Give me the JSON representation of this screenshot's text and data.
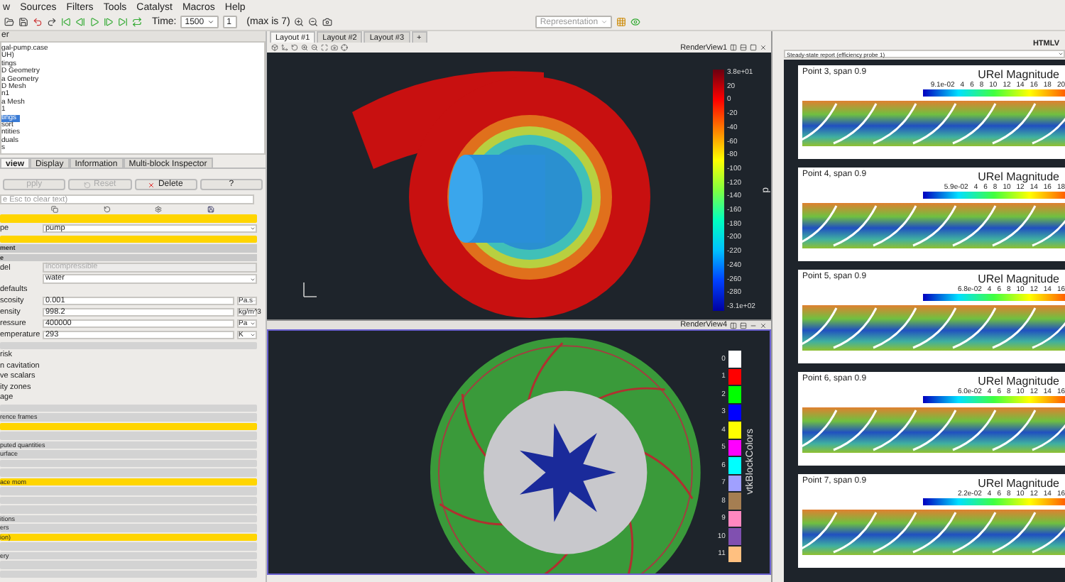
{
  "menu": [
    "w",
    "Sources",
    "Filters",
    "Tools",
    "Catalyst",
    "Macros",
    "Help"
  ],
  "time": {
    "label": "Time:",
    "value": "1500",
    "index": "1",
    "max": "(max is 7)"
  },
  "representation": {
    "placeholder": "Representation"
  },
  "pipeline": {
    "title": "er",
    "items": [
      {
        "label": "gal-pump.case",
        "selected": false
      },
      {
        "label": "UH)",
        "selected": false
      },
      {
        "label": "tings",
        "selected": false
      },
      {
        "label": "D Geometry",
        "selected": false
      },
      {
        "label": "a Geometry",
        "selected": false
      },
      {
        "label": "D Mesh",
        "selected": false
      },
      {
        "label": "n1",
        "selected": false
      },
      {
        "label": "a Mesh",
        "selected": false
      },
      {
        "label": "1",
        "selected": false
      },
      {
        "label": "tings",
        "selected": true
      },
      {
        "label": "sort",
        "selected": false
      },
      {
        "label": "ntities",
        "selected": false
      },
      {
        "label": "duals",
        "selected": false
      },
      {
        "label": "s",
        "selected": false
      }
    ]
  },
  "panel_tabs": [
    {
      "label": "view",
      "selected": true
    },
    {
      "label": "Display",
      "selected": false
    },
    {
      "label": "Information",
      "selected": false
    },
    {
      "label": "Multi-block Inspector",
      "selected": false
    }
  ],
  "actions": [
    {
      "label": "pply",
      "kind": "apply",
      "disabled": true
    },
    {
      "label": "Reset",
      "kind": "reset",
      "disabled": true
    },
    {
      "label": "Delete",
      "kind": "delete",
      "disabled": false
    },
    {
      "label": "?",
      "kind": "help",
      "disabled": false
    }
  ],
  "search": {
    "placeholder": "e Esc to clear text)"
  },
  "properties": [
    {
      "kind": "bar",
      "highlighted": true
    },
    {
      "kind": "select",
      "label": "pe",
      "value": "pump"
    },
    {
      "kind": "bar",
      "highlighted": true
    },
    {
      "kind": "header",
      "label": "ment"
    },
    {
      "kind": "header",
      "label": "e"
    },
    {
      "kind": "field",
      "label": "del",
      "value": "incompressible",
      "disabled": true
    },
    {
      "kind": "select",
      "value": "water"
    },
    {
      "kind": "text",
      "label": "defaults"
    },
    {
      "kind": "field",
      "label": "scosity",
      "value": "0.001",
      "unit": "Pa.s",
      "disabled": false
    },
    {
      "kind": "field",
      "label": "ensity",
      "value": "998.2",
      "unit": "kg/m^3",
      "disabled": false
    },
    {
      "kind": "field",
      "label": "ressure",
      "value": "400000",
      "unit": "Pa",
      "disabled": false
    },
    {
      "kind": "field",
      "label": "emperature",
      "value": "293",
      "unit": "K",
      "disabled": false
    },
    {
      "kind": "bar",
      "highlighted": false
    },
    {
      "kind": "text",
      "label": "risk"
    },
    {
      "kind": "text",
      "label": "n cavitation"
    },
    {
      "kind": "text",
      "label": "ve scalars"
    },
    {
      "kind": "text",
      "label": "ity zones"
    },
    {
      "kind": "text",
      "label": "age"
    },
    {
      "kind": "bar",
      "highlighted": false
    },
    {
      "kind": "bar",
      "highlighted": false,
      "label": "rence frames"
    },
    {
      "kind": "bar",
      "highlighted": true
    },
    {
      "kind": "bar",
      "highlighted": false
    },
    {
      "kind": "bar",
      "highlighted": false,
      "label": "puted quantities"
    },
    {
      "kind": "bar",
      "highlighted": false,
      "label": "urface"
    },
    {
      "kind": "bar",
      "highlighted": false
    },
    {
      "kind": "bar",
      "highlighted": false
    },
    {
      "kind": "bar",
      "highlighted": true,
      "label": "ace mom"
    },
    {
      "kind": "bar",
      "highlighted": false
    },
    {
      "kind": "bar",
      "highlighted": false
    },
    {
      "kind": "bar",
      "highlighted": false
    },
    {
      "kind": "bar",
      "highlighted": false,
      "label": "itions"
    },
    {
      "kind": "bar",
      "highlighted": false,
      "label": "ers"
    },
    {
      "kind": "bar",
      "highlighted": true,
      "label": "ion)"
    },
    {
      "kind": "bar",
      "highlighted": false
    },
    {
      "kind": "bar",
      "highlighted": false,
      "label": "ery"
    },
    {
      "kind": "bar",
      "highlighted": false
    },
    {
      "kind": "bar",
      "highlighted": false
    }
  ],
  "layout_tabs": [
    {
      "label": "Layout #1",
      "selected": true
    },
    {
      "label": "Layout #2",
      "selected": false
    },
    {
      "label": "Layout #3",
      "selected": false
    }
  ],
  "add_tab": "+",
  "view1_title": "RenderView1",
  "view2_title": "RenderView4",
  "pressure_legend": {
    "title": "p",
    "labels": [
      "3.8e+01",
      "20",
      "0",
      "-20",
      "-40",
      "-60",
      "-80",
      "-100",
      "-120",
      "-140",
      "-160",
      "-180",
      "-200",
      "-220",
      "-240",
      "-260",
      "-280",
      "-3.1e+02"
    ]
  },
  "block_legend": {
    "title": "vtkBlockColors",
    "entries": [
      {
        "label": "0",
        "color": "#ffffff"
      },
      {
        "label": "1",
        "color": "#ff0000"
      },
      {
        "label": "2",
        "color": "#00ff00"
      },
      {
        "label": "3",
        "color": "#0000ff"
      },
      {
        "label": "4",
        "color": "#ffff00"
      },
      {
        "label": "5",
        "color": "#ff00ff"
      },
      {
        "label": "6",
        "color": "#00ffff"
      },
      {
        "label": "7",
        "color": "#a0a0ff"
      },
      {
        "label": "8",
        "color": "#a57e52"
      },
      {
        "label": "9",
        "color": "#ff88c0"
      },
      {
        "label": "10",
        "color": "#8050b0"
      },
      {
        "label": "11",
        "color": "#ffc080"
      }
    ]
  },
  "report": {
    "title": "HTMLV",
    "selector": "Steady-state report (efficiency probe 1)",
    "cards": [
      {
        "title": "Point 3, span 0.9",
        "quantity": "URel Magnitude",
        "ticks": [
          "9.1e-02",
          "4",
          "6",
          "8",
          "10",
          "12",
          "14",
          "16",
          "18",
          "20"
        ]
      },
      {
        "title": "Point 4, span 0.9",
        "quantity": "URel Magnitude",
        "ticks": [
          "5.9e-02",
          "4",
          "6",
          "8",
          "10",
          "12",
          "14",
          "16",
          "18"
        ]
      },
      {
        "title": "Point 5, span 0.9",
        "quantity": "URel Magnitude",
        "ticks": [
          "6.8e-02",
          "4",
          "6",
          "8",
          "10",
          "12",
          "14",
          "16"
        ]
      },
      {
        "title": "Point 6, span 0.9",
        "quantity": "URel Magnitude",
        "ticks": [
          "6.0e-02",
          "4",
          "6",
          "8",
          "10",
          "12",
          "14",
          "16"
        ]
      },
      {
        "title": "Point 7, span 0.9",
        "quantity": "URel Magnitude",
        "ticks": [
          "2.2e-02",
          "4",
          "6",
          "8",
          "10",
          "12",
          "14",
          "16"
        ]
      }
    ]
  }
}
